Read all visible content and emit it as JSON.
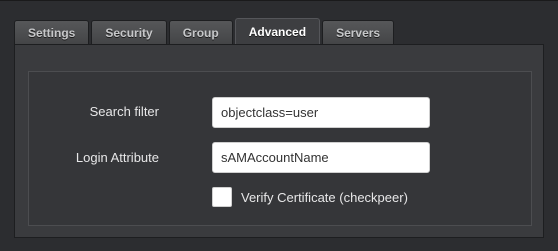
{
  "tabs": [
    {
      "label": "Settings",
      "active": false
    },
    {
      "label": "Security",
      "active": false
    },
    {
      "label": "Group",
      "active": false
    },
    {
      "label": "Advanced",
      "active": true
    },
    {
      "label": "Servers",
      "active": false
    }
  ],
  "form": {
    "search_filter_label": "Search filter",
    "search_filter_value": "objectclass=user",
    "login_attribute_label": "Login Attribute",
    "login_attribute_value": "sAMAccountName",
    "verify_certificate_label": "Verify Certificate (checkpeer)",
    "verify_certificate_checked": false
  },
  "colors": {
    "background": "#2c2d30",
    "panel": "#3a3b3e",
    "inner_panel": "#353639",
    "tab_text": "#c6c7c9",
    "active_tab_text": "#ffffff"
  }
}
